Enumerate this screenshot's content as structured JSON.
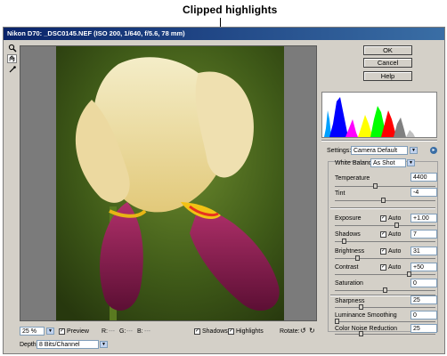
{
  "annotation": {
    "text": "Clipped highlights"
  },
  "window": {
    "title": "Nikon D70:  _DSC0145.NEF  (ISO 200, 1/640, f/5.6, 78 mm)"
  },
  "tools": [
    "zoom-icon",
    "hand-icon",
    "eyedropper-icon"
  ],
  "buttons": {
    "ok": "OK",
    "cancel": "Cancel",
    "help": "Help"
  },
  "settings": {
    "label": "Settings:",
    "value": "Camera Default"
  },
  "white_balance": {
    "label": "White Balance:",
    "value": "As Shot"
  },
  "temperature": {
    "label": "Temperature",
    "value": "4400",
    "level": 0.4
  },
  "tint": {
    "label": "Tint",
    "value": "-4",
    "level": 0.48
  },
  "exposure": {
    "label": "Exposure",
    "auto_label": "Auto",
    "auto": true,
    "value": "+1.00",
    "level": 0.62
  },
  "shadows": {
    "label": "Shadows",
    "auto_label": "Auto",
    "auto": true,
    "value": "7",
    "level": 0.07
  },
  "brightness": {
    "label": "Brightness",
    "auto_label": "Auto",
    "auto": true,
    "value": "31",
    "level": 0.21
  },
  "contrast": {
    "label": "Contrast",
    "auto_label": "Auto",
    "auto": true,
    "value": "+50",
    "level": 0.75
  },
  "saturation": {
    "label": "Saturation",
    "value": "0",
    "level": 0.5
  },
  "sharpness": {
    "label": "Sharpness",
    "value": "25",
    "level": 0.25
  },
  "luminance_smoothing": {
    "label": "Luminance Smoothing",
    "value": "0",
    "level": 0.0
  },
  "color_noise_reduction": {
    "label": "Color Noise Reduction",
    "value": "25",
    "level": 0.25
  },
  "bottom": {
    "zoom": "25 %",
    "preview_label": "Preview",
    "rgb": {
      "r": "R:",
      "g": "G:",
      "b": "B:",
      "r_val": "---",
      "g_val": "---",
      "b_val": "---"
    },
    "shadows_label": "Shadows",
    "highlights_label": "Highlights",
    "rotate_label": "Rotate:"
  },
  "depth": {
    "label": "Depth:",
    "value": "8 Bits/Channel"
  }
}
